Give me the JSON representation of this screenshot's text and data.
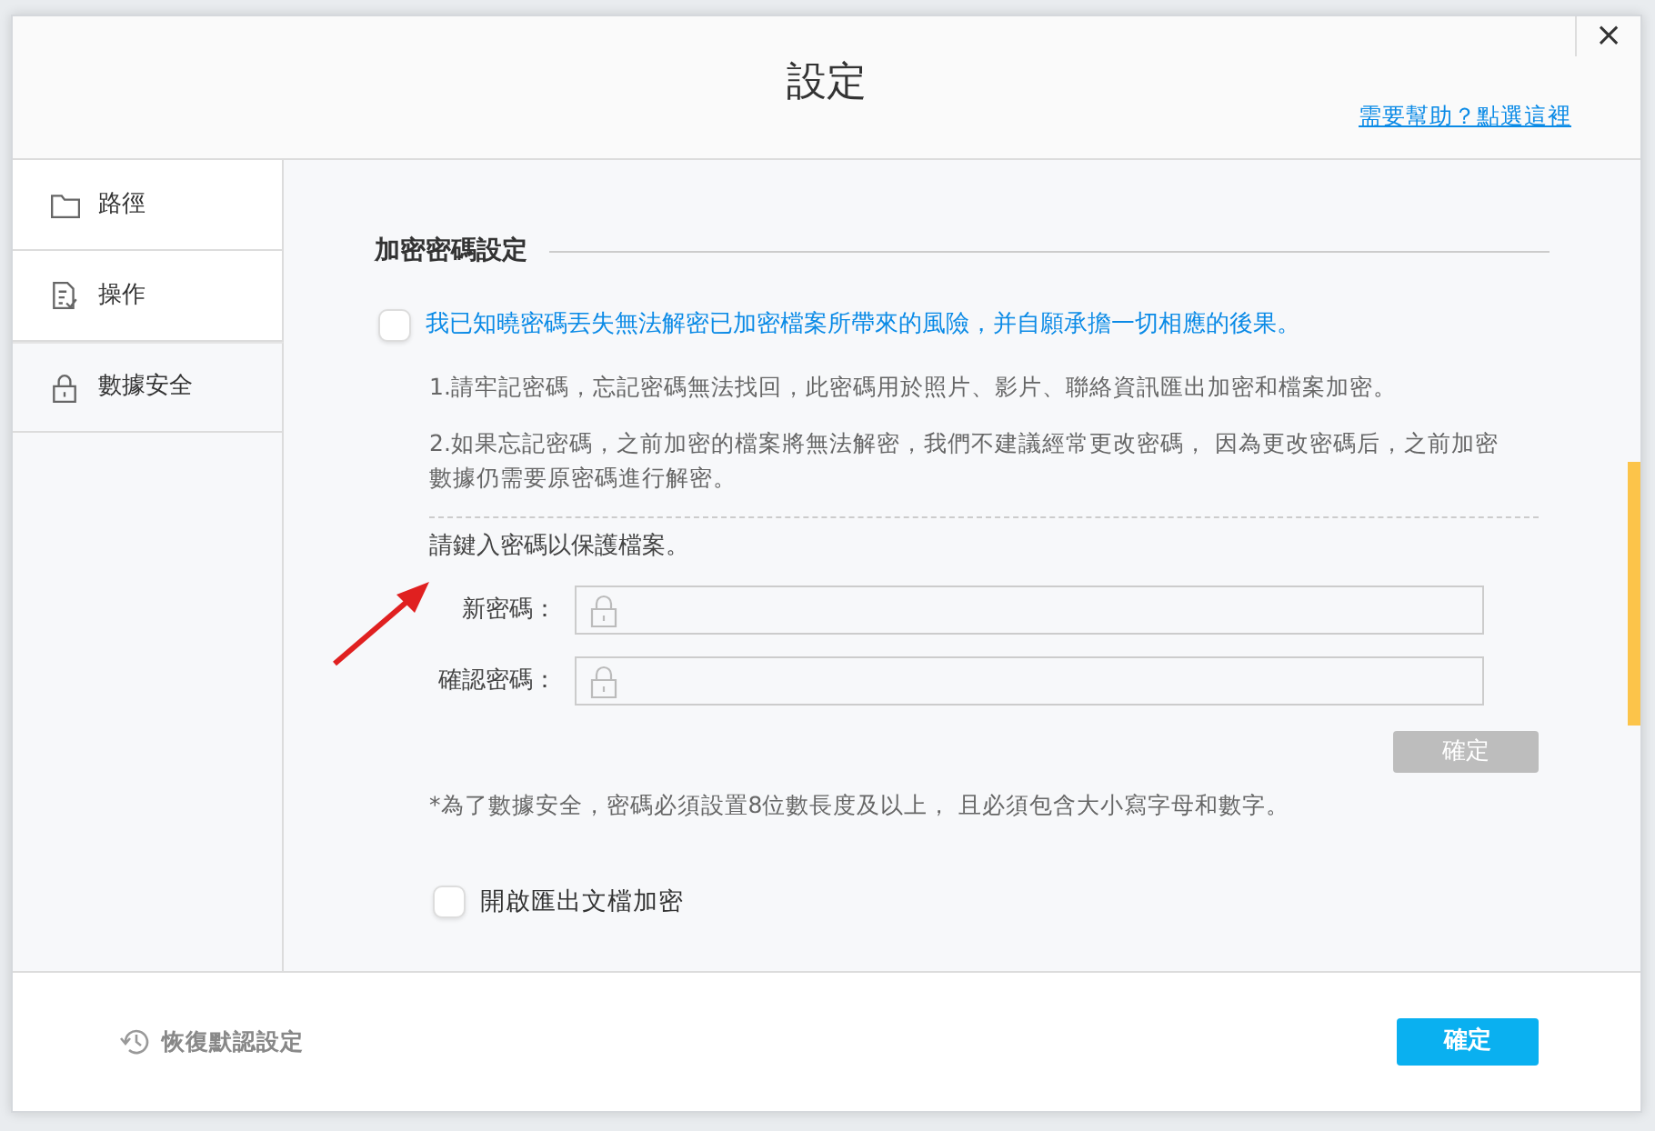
{
  "dialog": {
    "title": "設定",
    "help_link": "需要幫助？點選這裡",
    "close": "×"
  },
  "sidebar": {
    "items": [
      {
        "label": "路徑",
        "selected": false
      },
      {
        "label": "操作",
        "selected": false
      },
      {
        "label": "數據安全",
        "selected": true
      }
    ]
  },
  "section": {
    "heading": "加密密碼設定",
    "consent": {
      "label": "我已知曉密碼丟失無法解密已加密檔案所帶來的風險，并自願承擔一切相應的後果。",
      "checked": false
    },
    "notes": [
      "1.請牢記密碼，忘記密碼無法找回，此密碼用於照片、影片、聯絡資訊匯出加密和檔案加密。",
      "2.如果忘記密碼，之前加密的檔案將無法解密，我們不建議經常更改密碼， 因為更改密碼后，之前加密數據仍需要原密碼進行解密。"
    ],
    "prompt": "請鍵入密碼以保護檔案。",
    "fields": [
      {
        "label": "新密碼："
      },
      {
        "label": "確認密碼："
      }
    ],
    "confirm_button": {
      "label": "確定",
      "disabled": true
    },
    "requirement": "*為了數據安全，密碼必須設置8位數長度及以上， 且必須包含大小寫字母和數字。",
    "export_option": {
      "label": "開啟匯出文檔加密",
      "checked": false
    }
  },
  "footer": {
    "reset": "恢復默認設定",
    "ok_button": "確定"
  }
}
